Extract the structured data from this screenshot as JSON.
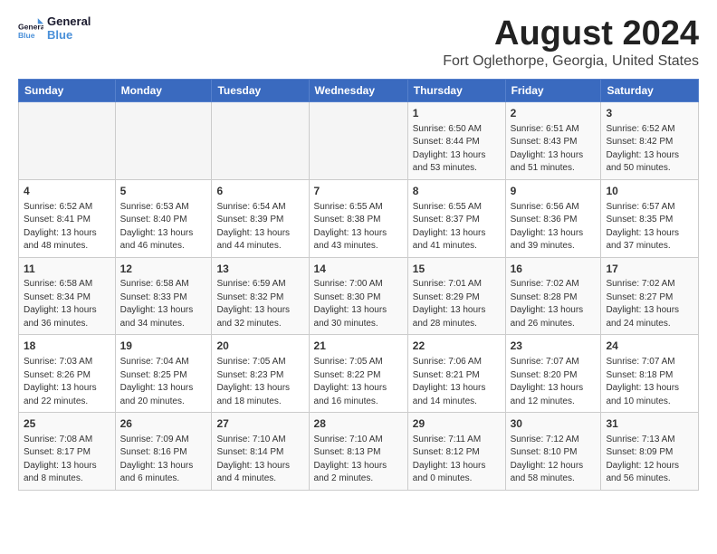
{
  "logo": {
    "line1": "General",
    "line2": "Blue"
  },
  "title": "August 2024",
  "subtitle": "Fort Oglethorpe, Georgia, United States",
  "days_of_week": [
    "Sunday",
    "Monday",
    "Tuesday",
    "Wednesday",
    "Thursday",
    "Friday",
    "Saturday"
  ],
  "weeks": [
    [
      {
        "day": "",
        "info": ""
      },
      {
        "day": "",
        "info": ""
      },
      {
        "day": "",
        "info": ""
      },
      {
        "day": "",
        "info": ""
      },
      {
        "day": "1",
        "info": "Sunrise: 6:50 AM\nSunset: 8:44 PM\nDaylight: 13 hours\nand 53 minutes."
      },
      {
        "day": "2",
        "info": "Sunrise: 6:51 AM\nSunset: 8:43 PM\nDaylight: 13 hours\nand 51 minutes."
      },
      {
        "day": "3",
        "info": "Sunrise: 6:52 AM\nSunset: 8:42 PM\nDaylight: 13 hours\nand 50 minutes."
      }
    ],
    [
      {
        "day": "4",
        "info": "Sunrise: 6:52 AM\nSunset: 8:41 PM\nDaylight: 13 hours\nand 48 minutes."
      },
      {
        "day": "5",
        "info": "Sunrise: 6:53 AM\nSunset: 8:40 PM\nDaylight: 13 hours\nand 46 minutes."
      },
      {
        "day": "6",
        "info": "Sunrise: 6:54 AM\nSunset: 8:39 PM\nDaylight: 13 hours\nand 44 minutes."
      },
      {
        "day": "7",
        "info": "Sunrise: 6:55 AM\nSunset: 8:38 PM\nDaylight: 13 hours\nand 43 minutes."
      },
      {
        "day": "8",
        "info": "Sunrise: 6:55 AM\nSunset: 8:37 PM\nDaylight: 13 hours\nand 41 minutes."
      },
      {
        "day": "9",
        "info": "Sunrise: 6:56 AM\nSunset: 8:36 PM\nDaylight: 13 hours\nand 39 minutes."
      },
      {
        "day": "10",
        "info": "Sunrise: 6:57 AM\nSunset: 8:35 PM\nDaylight: 13 hours\nand 37 minutes."
      }
    ],
    [
      {
        "day": "11",
        "info": "Sunrise: 6:58 AM\nSunset: 8:34 PM\nDaylight: 13 hours\nand 36 minutes."
      },
      {
        "day": "12",
        "info": "Sunrise: 6:58 AM\nSunset: 8:33 PM\nDaylight: 13 hours\nand 34 minutes."
      },
      {
        "day": "13",
        "info": "Sunrise: 6:59 AM\nSunset: 8:32 PM\nDaylight: 13 hours\nand 32 minutes."
      },
      {
        "day": "14",
        "info": "Sunrise: 7:00 AM\nSunset: 8:30 PM\nDaylight: 13 hours\nand 30 minutes."
      },
      {
        "day": "15",
        "info": "Sunrise: 7:01 AM\nSunset: 8:29 PM\nDaylight: 13 hours\nand 28 minutes."
      },
      {
        "day": "16",
        "info": "Sunrise: 7:02 AM\nSunset: 8:28 PM\nDaylight: 13 hours\nand 26 minutes."
      },
      {
        "day": "17",
        "info": "Sunrise: 7:02 AM\nSunset: 8:27 PM\nDaylight: 13 hours\nand 24 minutes."
      }
    ],
    [
      {
        "day": "18",
        "info": "Sunrise: 7:03 AM\nSunset: 8:26 PM\nDaylight: 13 hours\nand 22 minutes."
      },
      {
        "day": "19",
        "info": "Sunrise: 7:04 AM\nSunset: 8:25 PM\nDaylight: 13 hours\nand 20 minutes."
      },
      {
        "day": "20",
        "info": "Sunrise: 7:05 AM\nSunset: 8:23 PM\nDaylight: 13 hours\nand 18 minutes."
      },
      {
        "day": "21",
        "info": "Sunrise: 7:05 AM\nSunset: 8:22 PM\nDaylight: 13 hours\nand 16 minutes."
      },
      {
        "day": "22",
        "info": "Sunrise: 7:06 AM\nSunset: 8:21 PM\nDaylight: 13 hours\nand 14 minutes."
      },
      {
        "day": "23",
        "info": "Sunrise: 7:07 AM\nSunset: 8:20 PM\nDaylight: 13 hours\nand 12 minutes."
      },
      {
        "day": "24",
        "info": "Sunrise: 7:07 AM\nSunset: 8:18 PM\nDaylight: 13 hours\nand 10 minutes."
      }
    ],
    [
      {
        "day": "25",
        "info": "Sunrise: 7:08 AM\nSunset: 8:17 PM\nDaylight: 13 hours\nand 8 minutes."
      },
      {
        "day": "26",
        "info": "Sunrise: 7:09 AM\nSunset: 8:16 PM\nDaylight: 13 hours\nand 6 minutes."
      },
      {
        "day": "27",
        "info": "Sunrise: 7:10 AM\nSunset: 8:14 PM\nDaylight: 13 hours\nand 4 minutes."
      },
      {
        "day": "28",
        "info": "Sunrise: 7:10 AM\nSunset: 8:13 PM\nDaylight: 13 hours\nand 2 minutes."
      },
      {
        "day": "29",
        "info": "Sunrise: 7:11 AM\nSunset: 8:12 PM\nDaylight: 13 hours\nand 0 minutes."
      },
      {
        "day": "30",
        "info": "Sunrise: 7:12 AM\nSunset: 8:10 PM\nDaylight: 12 hours\nand 58 minutes."
      },
      {
        "day": "31",
        "info": "Sunrise: 7:13 AM\nSunset: 8:09 PM\nDaylight: 12 hours\nand 56 minutes."
      }
    ]
  ]
}
